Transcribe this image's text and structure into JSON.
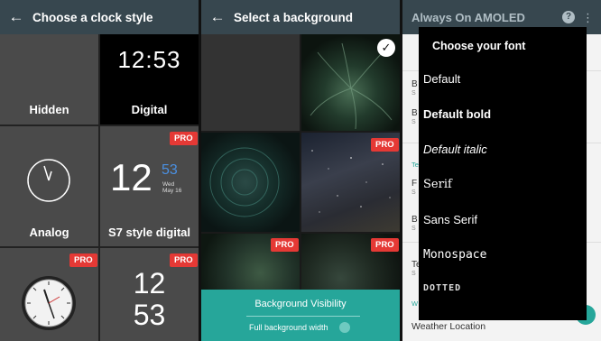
{
  "panel1": {
    "back_icon": "arrow-left-icon",
    "title": "Choose a clock style",
    "styles": [
      {
        "label": "Hidden",
        "pro": false
      },
      {
        "label": "Digital",
        "pro": false,
        "time": "12:53"
      },
      {
        "label": "Analog",
        "pro": false
      },
      {
        "label": "S7 style digital",
        "pro": true,
        "hour": "12",
        "minute": "53",
        "day": "Wed",
        "date": "May 16"
      },
      {
        "label": "",
        "pro": true
      },
      {
        "label": "",
        "pro": true,
        "hour": "12",
        "minute": "53"
      }
    ],
    "pro_label": "PRO"
  },
  "panel2": {
    "back_icon": "arrow-left-icon",
    "title": "Select a background",
    "pro_label": "PRO",
    "visibility_label": "Background Visibility",
    "full_width_label": "Full background width"
  },
  "panel3": {
    "app_title": "Always On AMOLED",
    "help_icon": "help-icon",
    "menu_icon": "more-vert-icon",
    "behind_letters": [
      "B",
      "S",
      "B",
      "S",
      "Te",
      "F",
      "S",
      "B",
      "S",
      "Te",
      "S",
      "Te",
      "S",
      "W"
    ],
    "weather_location": "Weather Location",
    "dialog": {
      "title": "Choose your font",
      "options": [
        "Default",
        "Default bold",
        "Default italic",
        "Serif",
        "Sans Serif",
        "Monospace",
        "DOTTED"
      ]
    }
  },
  "colors": {
    "toolbar": "#37474f",
    "pro_badge": "#e53935",
    "accent": "#26a69a"
  }
}
